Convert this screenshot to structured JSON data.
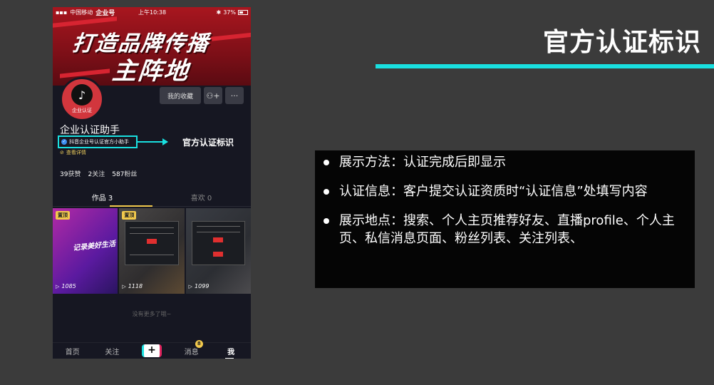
{
  "slide": {
    "title": "官方认证标识",
    "accent_color": "#19e0e0"
  },
  "phone": {
    "status_bar": {
      "carrier": "中国移动",
      "app_brand": "企业号",
      "time": "上午10:38",
      "battery": "37%"
    },
    "banner": {
      "line1": "打造品牌传播",
      "line2": "主阵地"
    },
    "avatar": {
      "logo_icon": "tiktok-note-icon",
      "badge": "企业认证"
    },
    "buttons": {
      "favorites": "我的收藏",
      "add_friend_icon": "person-plus-icon",
      "more_icon": "ellipsis-icon",
      "more_glyph": "···",
      "add_friend_glyph": "⚇+"
    },
    "profile": {
      "display_name": "企业认证助手",
      "verify_text": "抖音企业号认证官方小助手",
      "verify_check_glyph": "✓",
      "details_link": "查看详情",
      "details_icon_glyph": "⊘",
      "callout": "官方认证标识"
    },
    "stats": [
      {
        "value": "39",
        "label": "获赞"
      },
      {
        "value": "2",
        "label": "关注"
      },
      {
        "value": "587",
        "label": "粉丝"
      }
    ],
    "tabs": [
      {
        "label": "作品 3"
      },
      {
        "label": "喜欢 0"
      }
    ],
    "videos": [
      {
        "pin": "置顶",
        "caption": "记录美好生活",
        "plays": "1085"
      },
      {
        "pin": "置顶",
        "plays": "1118"
      },
      {
        "plays": "1099"
      }
    ],
    "play_glyph": "▷",
    "no_more": "没有更多了哦~",
    "nav": {
      "home": "首页",
      "following": "关注",
      "plus_glyph": "+",
      "messages": "消息",
      "messages_badge": "8",
      "me": "我"
    }
  },
  "info": {
    "items": [
      "展示方法：认证完成后即显示",
      "认证信息：客户提交认证资质时“认证信息”处填写内容",
      "展示地点：搜索、个人主页推荐好友、直播profile、个人主页、私信消息页面、粉丝列表、关注列表、"
    ]
  }
}
